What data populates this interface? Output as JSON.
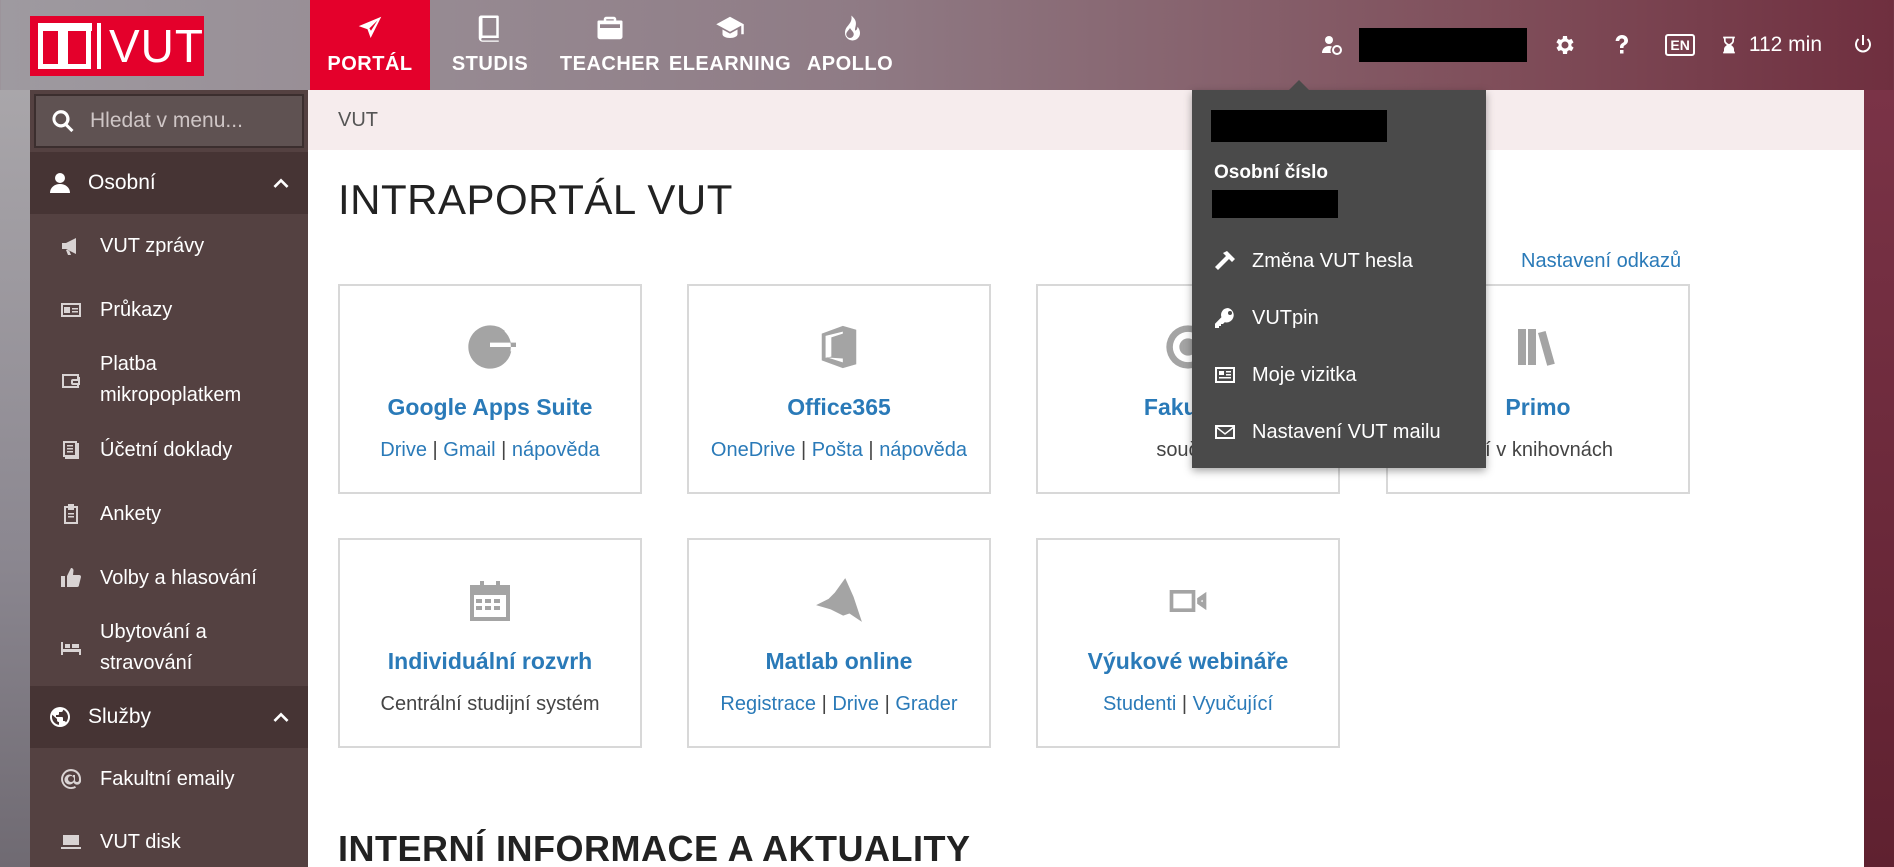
{
  "logo": {
    "text": "VUT"
  },
  "nav": {
    "items": [
      {
        "label": "PORTÁL",
        "icon": "paper-plane-icon",
        "active": true
      },
      {
        "label": "STUDIS",
        "icon": "book-icon",
        "active": false
      },
      {
        "label": "TEACHER",
        "icon": "briefcase-icon",
        "active": false
      },
      {
        "label": "ELEARNING",
        "icon": "graduation-cap-icon",
        "active": false
      },
      {
        "label": "APOLLO",
        "icon": "flame-icon",
        "active": false
      }
    ]
  },
  "toolbar": {
    "language": "EN",
    "timer": "112 min"
  },
  "sidebar": {
    "search_placeholder": "Hledat v menu...",
    "sections": [
      {
        "label": "Osobní",
        "items": [
          {
            "label": "VUT zprávy",
            "icon": "megaphone-icon"
          },
          {
            "label": "Průkazy",
            "icon": "id-card-icon"
          },
          {
            "label": "Platba mikropoplatkem",
            "icon": "wallet-icon"
          },
          {
            "label": "Účetní doklady",
            "icon": "receipt-icon"
          },
          {
            "label": "Ankety",
            "icon": "clipboard-icon"
          },
          {
            "label": "Volby a hlasování",
            "icon": "thumbs-up-icon"
          },
          {
            "label": "Ubytování a stravování",
            "icon": "bed-icon"
          }
        ]
      },
      {
        "label": "Služby",
        "items": [
          {
            "label": "Fakultní emaily",
            "icon": "at-icon"
          },
          {
            "label": "VUT disk",
            "icon": "laptop-icon"
          }
        ]
      }
    ]
  },
  "breadcrumb": "VUT",
  "main": {
    "title": "INTRAPORTÁL VUT",
    "settings_link": "Nastavení odkazů",
    "tiles": [
      {
        "title": "Google Apps Suite",
        "icon": "google-icon",
        "links": [
          "Drive",
          "Gmail",
          "nápověda"
        ]
      },
      {
        "title": "Office365",
        "icon": "office-icon",
        "links": [
          "OneDrive",
          "Pošta",
          "nápověda"
        ]
      },
      {
        "title": "Fakultní",
        "icon": "target-icon",
        "text": "součás"
      },
      {
        "title": "Primo",
        "icon": "library-icon",
        "text": "ání v knihovnách"
      },
      {
        "title": "Individuální rozvrh",
        "icon": "calendar-icon",
        "text": "Centrální studijní systém"
      },
      {
        "title": "Matlab online",
        "icon": "matlab-icon",
        "links": [
          "Registrace",
          "Drive",
          "Grader"
        ]
      },
      {
        "title": "Výukové webináře",
        "icon": "video-camera-icon",
        "links": [
          "Studenti",
          "Vyučující"
        ]
      }
    ],
    "section_title": "INTERNÍ INFORMACE A AKTUALITY"
  },
  "dropdown": {
    "label": "Osobní číslo",
    "items": [
      {
        "label": "Změna VUT hesla",
        "icon": "hammer-icon"
      },
      {
        "label": "VUTpin",
        "icon": "key-icon"
      },
      {
        "label": "Moje vizitka",
        "icon": "business-card-icon"
      },
      {
        "label": "Nastavení VUT mailu",
        "icon": "envelope-icon"
      }
    ]
  },
  "colors": {
    "brand_red": "#e4002b",
    "link_blue": "#2a7ab8",
    "sidebar_bg": "#544141",
    "dropdown_bg": "#4a4a4a"
  }
}
